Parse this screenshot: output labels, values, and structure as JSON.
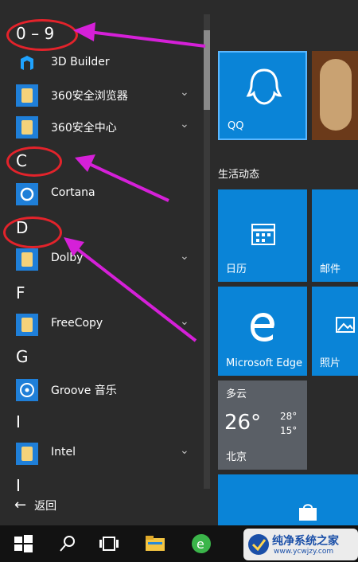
{
  "app_list": {
    "groups": [
      {
        "heading": "0 – 9",
        "apps": [
          {
            "label": "3D Builder",
            "icon": "3d-builder-icon",
            "expandable": false
          },
          {
            "label": "360安全浏览器",
            "icon": "folder-icon",
            "expandable": true
          },
          {
            "label": "360安全中心",
            "icon": "folder-icon",
            "expandable": true
          }
        ]
      },
      {
        "heading": "C",
        "apps": [
          {
            "label": "Cortana",
            "icon": "cortana-icon",
            "expandable": false
          }
        ]
      },
      {
        "heading": "D",
        "apps": [
          {
            "label": "Dolby",
            "icon": "folder-icon",
            "expandable": true
          }
        ]
      },
      {
        "heading": "F",
        "apps": [
          {
            "label": "FreeCopy",
            "icon": "folder-icon",
            "expandable": true
          }
        ]
      },
      {
        "heading": "G",
        "apps": [
          {
            "label": "Groove 音乐",
            "icon": "groove-music-icon",
            "expandable": false
          }
        ]
      },
      {
        "heading": "I",
        "apps": [
          {
            "label": "Intel",
            "icon": "folder-icon",
            "expandable": true
          }
        ]
      },
      {
        "heading": "I",
        "apps": []
      }
    ],
    "back_label": "返回"
  },
  "tiles": {
    "section_title": "生活动态",
    "qq": "QQ",
    "calendar": "日历",
    "mail": "邮件",
    "edge": "Microsoft Edge",
    "photos": "照片",
    "weather": {
      "condition": "多云",
      "temp": "26°",
      "high": "28°",
      "low": "15°",
      "city": "北京"
    }
  },
  "watermark": {
    "title": "纯净系统之家",
    "url": "www.ycwjzy.com"
  },
  "colors": {
    "tile_blue": "#0a84d7",
    "annotation_red": "#e3232b",
    "annotation_magenta": "#d520d8"
  }
}
